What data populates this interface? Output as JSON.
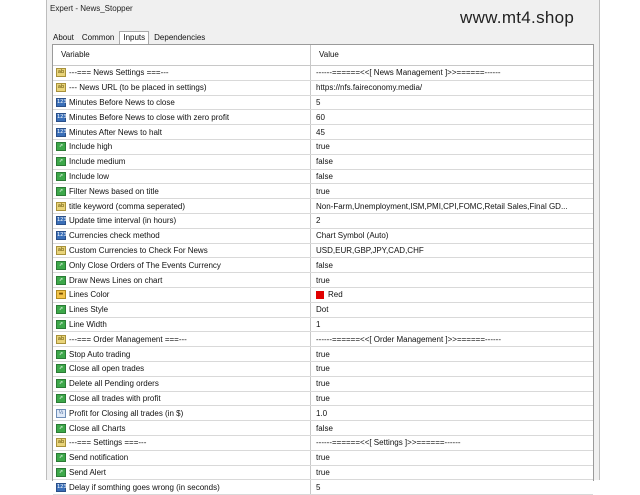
{
  "window": {
    "title": "Expert - News_Stopper"
  },
  "watermark": "www.mt4.shop",
  "tabs": [
    {
      "label": "About"
    },
    {
      "label": "Common"
    },
    {
      "label": "Inputs",
      "active": true
    },
    {
      "label": "Dependencies"
    }
  ],
  "table": {
    "headers": {
      "variable": "Variable",
      "value": "Value"
    },
    "rows": [
      {
        "type": "str",
        "name": "---=== News Settings ===---",
        "value": "------======<<[  News Management  ]>>======------"
      },
      {
        "type": "str",
        "name": "--- News URL (to be placed in settings)",
        "value": "https://nfs.faireconomy.media/"
      },
      {
        "type": "int",
        "name": "Minutes Before News to close",
        "value": "5"
      },
      {
        "type": "int",
        "name": "Minutes Before News to close with zero profit",
        "value": "60"
      },
      {
        "type": "int",
        "name": "Minutes After News to halt",
        "value": "45"
      },
      {
        "type": "bool",
        "name": "Include high",
        "value": "true"
      },
      {
        "type": "bool",
        "name": "Include medium",
        "value": "false"
      },
      {
        "type": "bool",
        "name": "Include low",
        "value": "false"
      },
      {
        "type": "bool",
        "name": "Filter News based on title",
        "value": "true"
      },
      {
        "type": "str",
        "name": "title keyword (comma seperated)",
        "value": "Non-Farm,Unemployment,ISM,PMI,CPI,FOMC,Retail Sales,Final GD..."
      },
      {
        "type": "int",
        "name": "Update time interval (in hours)",
        "value": "2"
      },
      {
        "type": "int",
        "name": "Currencies check method",
        "value": "Chart Symbol (Auto)"
      },
      {
        "type": "str",
        "name": "Custom Currencies to Check For News",
        "value": "USD,EUR,GBP,JPY,CAD,CHF"
      },
      {
        "type": "bool",
        "name": "Only Close Orders of The Events Currency",
        "value": "false"
      },
      {
        "type": "bool",
        "name": "Draw News Lines on chart",
        "value": "true"
      },
      {
        "type": "clr",
        "name": "Lines Color",
        "value": "Red",
        "color": "#e00000"
      },
      {
        "type": "bool",
        "name": "Lines Style",
        "value": "Dot"
      },
      {
        "type": "bool",
        "name": "Line Width",
        "value": "1"
      },
      {
        "type": "str",
        "name": "---=== Order Management ===---",
        "value": "------======<<[  Order Management  ]>>======------"
      },
      {
        "type": "bool",
        "name": "Stop Auto trading",
        "value": "true"
      },
      {
        "type": "bool",
        "name": "Close all open trades",
        "value": "true"
      },
      {
        "type": "bool",
        "name": "Delete all Pending orders",
        "value": "true"
      },
      {
        "type": "bool",
        "name": "Close all trades with profit",
        "value": "true"
      },
      {
        "type": "dbl",
        "name": "Profit for Closing all trades (in $)",
        "value": "1.0"
      },
      {
        "type": "bool",
        "name": "Close all Charts",
        "value": "false"
      },
      {
        "type": "str",
        "name": "---=== Settings ===---",
        "value": "------======<<[  Settings  ]>>======------"
      },
      {
        "type": "bool",
        "name": "Send notification",
        "value": "true"
      },
      {
        "type": "bool",
        "name": "Send Alert",
        "value": "true"
      },
      {
        "type": "int",
        "name": "Delay if somthing goes wrong (in seconds)",
        "value": "5"
      }
    ]
  },
  "icon_glyphs": {
    "str": "ab",
    "int": "123",
    "bool": "⇗",
    "dbl": "½",
    "clr": "▬"
  }
}
